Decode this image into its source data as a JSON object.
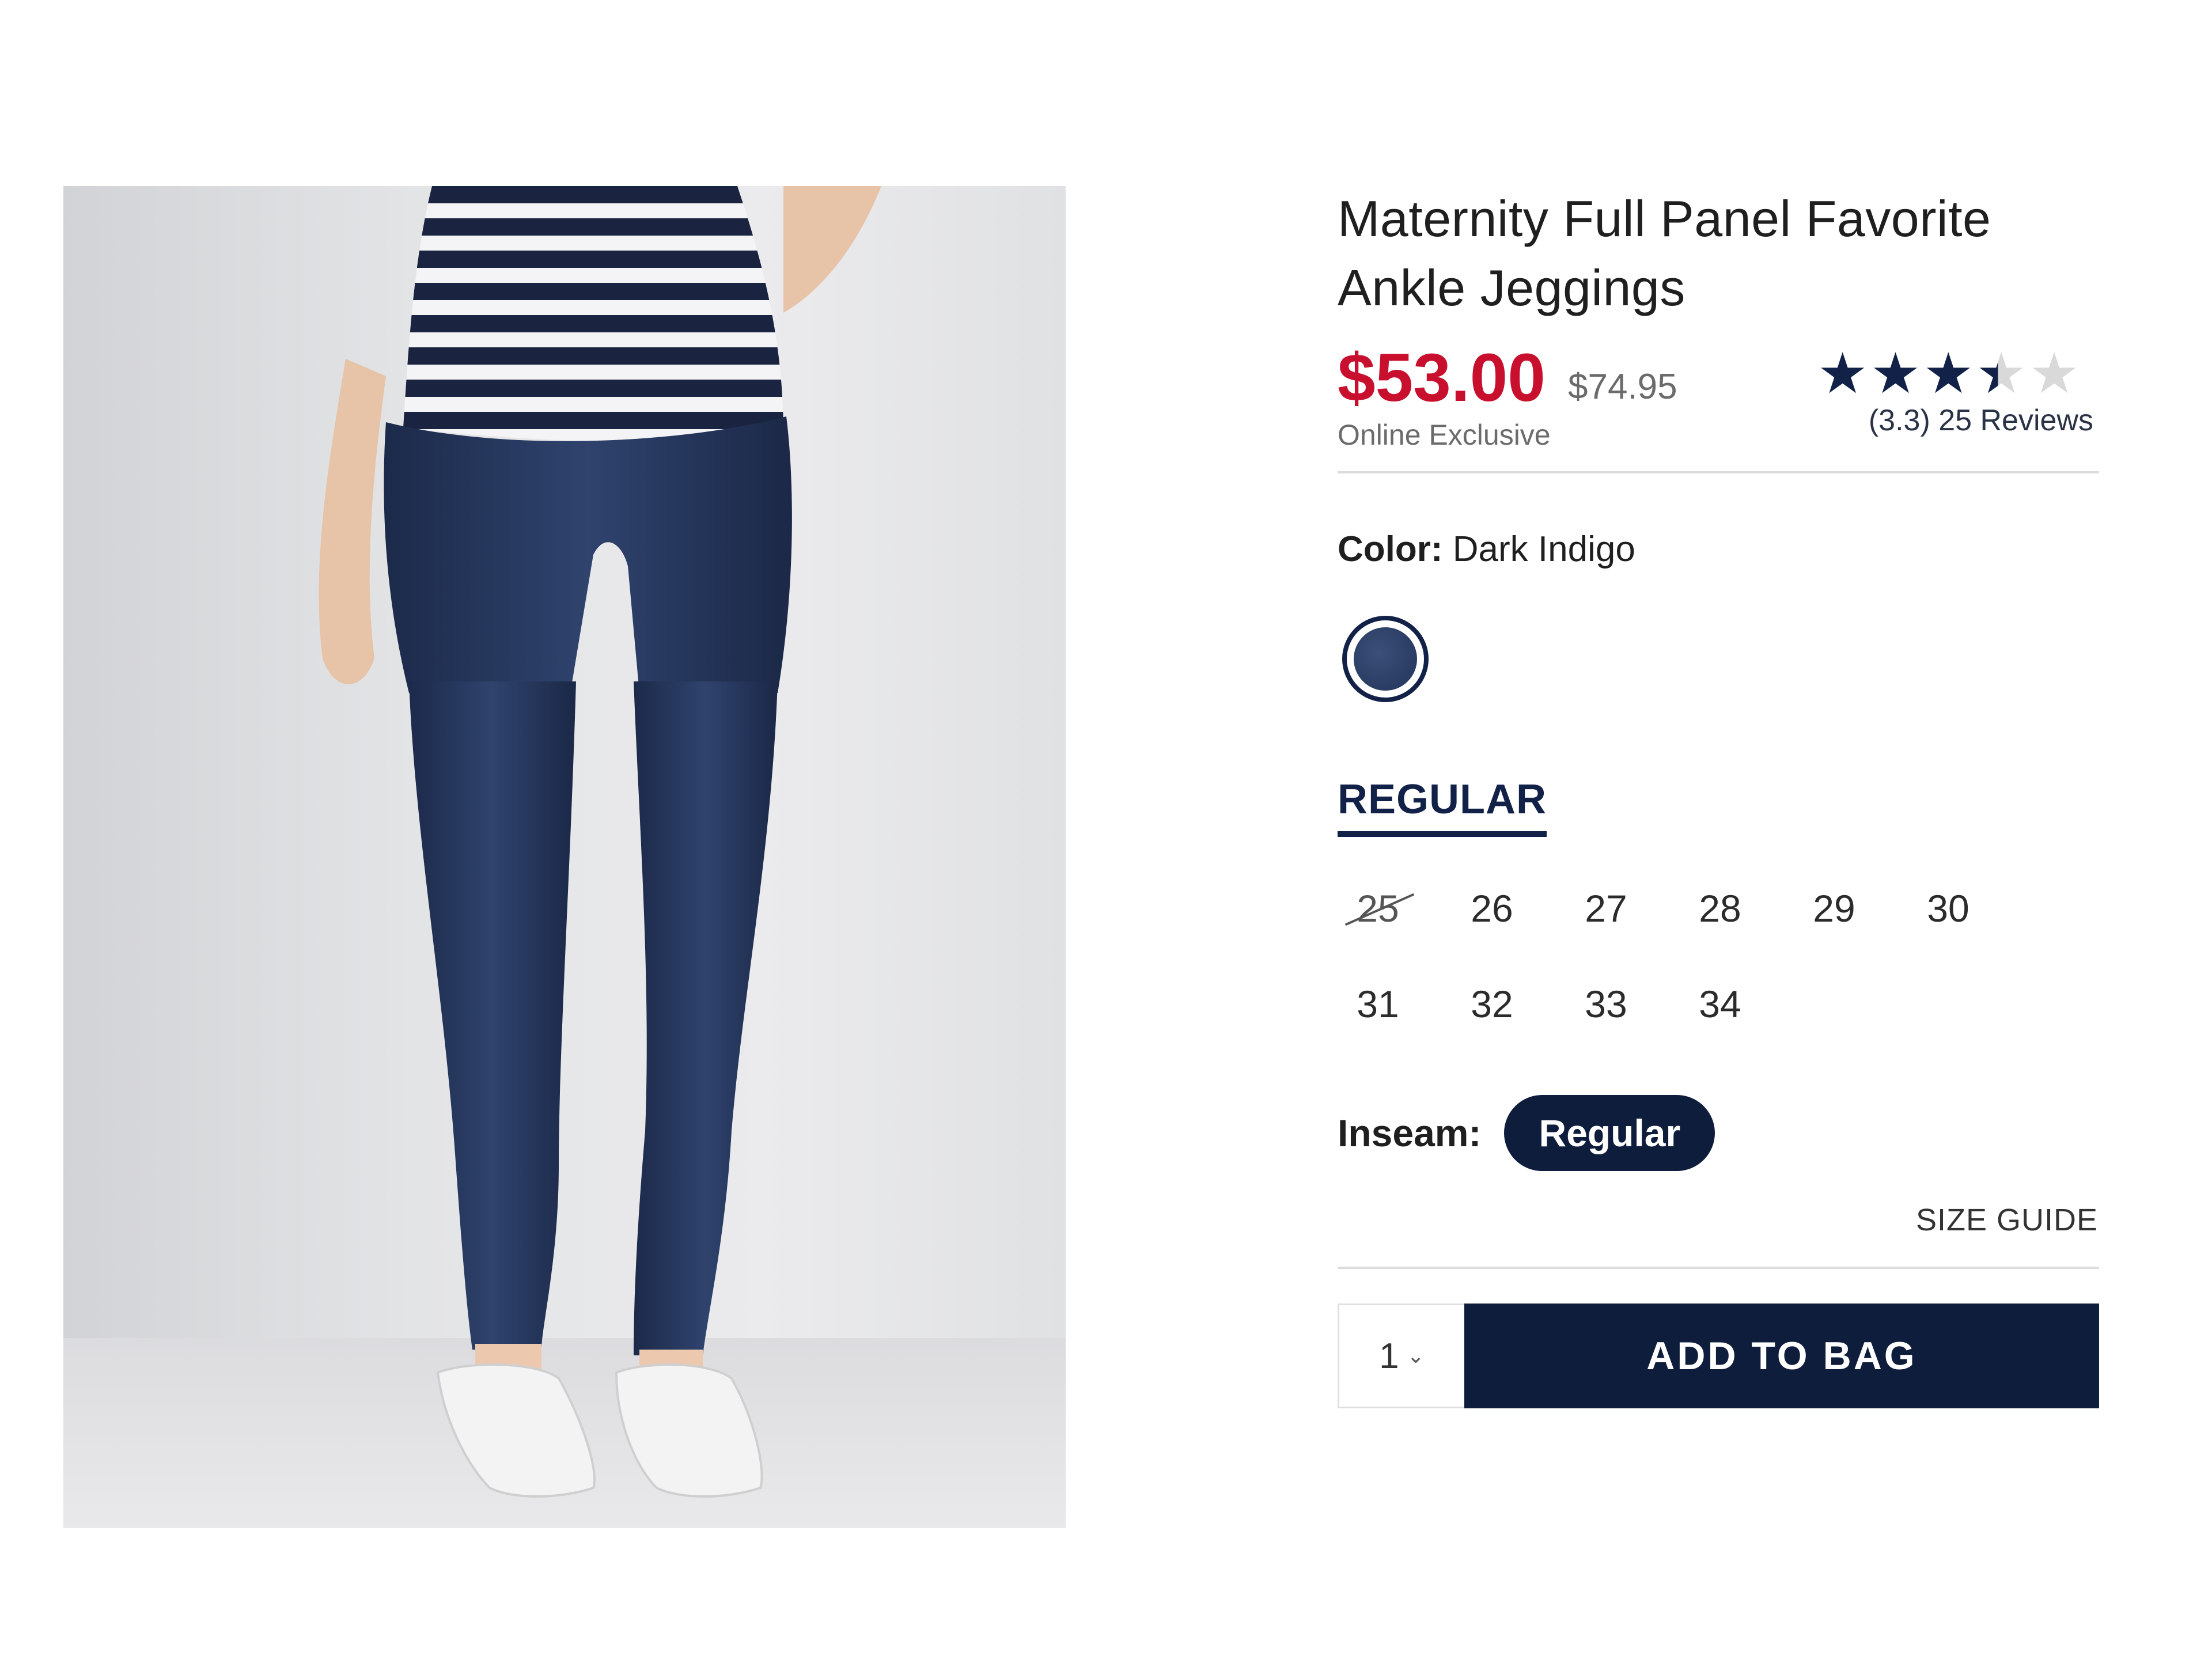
{
  "product": {
    "title_line1": "Maternity Full Panel Favorite",
    "title_line2": "Ankle Jeggings",
    "sale_price": "$53.00",
    "original_price": "$74.95",
    "badge": "Online Exclusive",
    "rating": 3.3,
    "rating_text": "(3.3) 25 Reviews"
  },
  "color": {
    "label": "Color:",
    "value": "Dark Indigo",
    "swatch_hex": "#2a3a62"
  },
  "fit": {
    "tab_label": "REGULAR",
    "sizes_row1": [
      "25",
      "26",
      "27",
      "28",
      "29",
      "30"
    ],
    "sizes_row2": [
      "31",
      "32",
      "33",
      "34"
    ],
    "unavailable": [
      "25"
    ]
  },
  "inseam": {
    "label": "Inseam:",
    "selected": "Regular"
  },
  "links": {
    "size_guide": "SIZE GUIDE"
  },
  "cart": {
    "quantity": "1",
    "add_label": "ADD TO BAG"
  },
  "colors": {
    "sale_red": "#c8102e",
    "navy": "#0f1d3c",
    "star_navy": "#122147"
  }
}
